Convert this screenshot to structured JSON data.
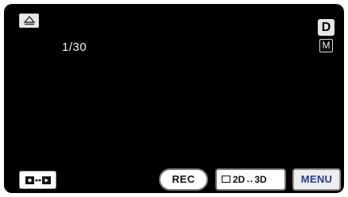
{
  "top_left": {
    "icon": "eject-icon"
  },
  "playback": {
    "counter": "1/30"
  },
  "badges": {
    "d": "D",
    "m": "M"
  },
  "bottom_bar": {
    "mode_switch_icon": "camera-video-switch-icon",
    "rec_label": "REC",
    "threed_label": "2D↔3D",
    "menu_label": "MENU"
  },
  "colors": {
    "background": "#000000",
    "menu_text": "#1e3aa0"
  }
}
